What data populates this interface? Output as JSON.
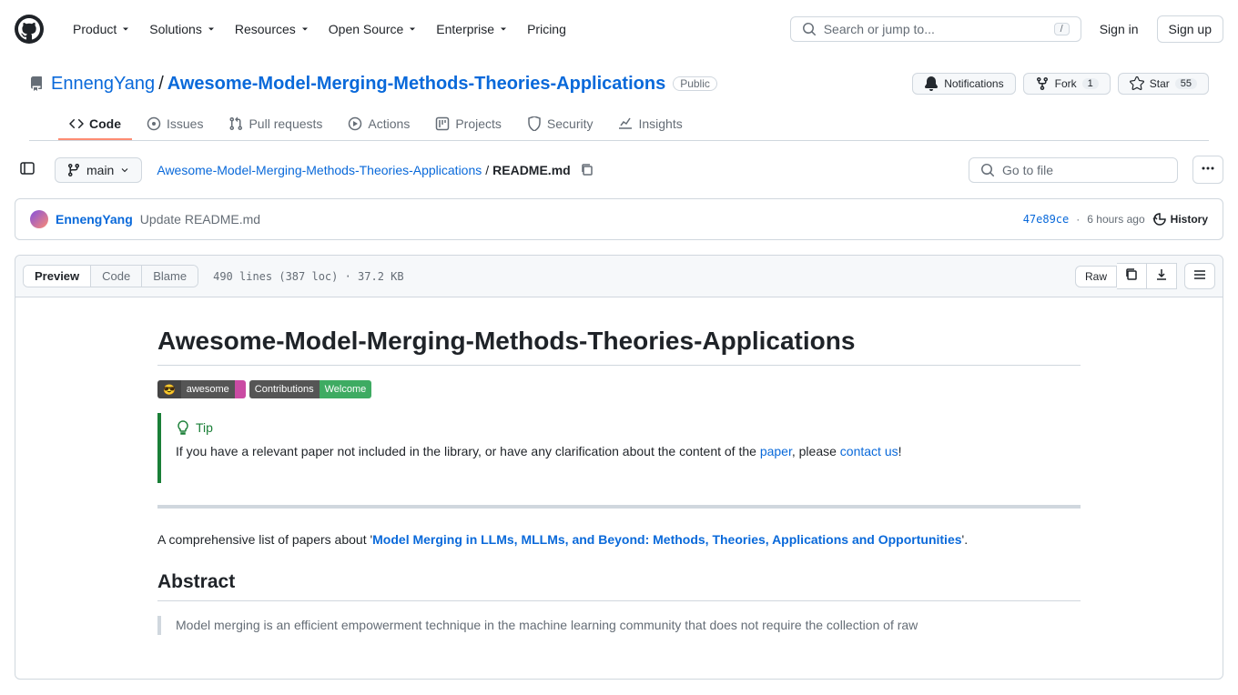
{
  "nav": {
    "product": "Product",
    "solutions": "Solutions",
    "resources": "Resources",
    "opensource": "Open Source",
    "enterprise": "Enterprise",
    "pricing": "Pricing",
    "searchPlaceholder": "Search or jump to...",
    "signin": "Sign in",
    "signup": "Sign up"
  },
  "repo": {
    "owner": "EnnengYang",
    "name": "Awesome-Model-Merging-Methods-Theories-Applications",
    "visibility": "Public",
    "notifications": "Notifications",
    "fork": "Fork",
    "forkCount": "1",
    "star": "Star",
    "starCount": "55"
  },
  "tabs": {
    "code": "Code",
    "issues": "Issues",
    "pulls": "Pull requests",
    "actions": "Actions",
    "projects": "Projects",
    "security": "Security",
    "insights": "Insights"
  },
  "fileNav": {
    "branch": "main",
    "repoLink": "Awesome-Model-Merging-Methods-Theories-Applications",
    "fileName": "README.md",
    "goToFile": "Go to file"
  },
  "commit": {
    "author": "EnnengYang",
    "message": "Update README.md",
    "sha": "47e89ce",
    "time": "6 hours ago",
    "history": "History"
  },
  "fileView": {
    "preview": "Preview",
    "code": "Code",
    "blame": "Blame",
    "info": "490 lines (387 loc) · 37.2 KB",
    "raw": "Raw"
  },
  "md": {
    "title": "Awesome-Model-Merging-Methods-Theories-Applications",
    "badge1Left": "😎 awesome",
    "badge2Left": "Contributions",
    "badge2Right": "Welcome",
    "tipLabel": "Tip",
    "tipTextPre": "If you have a relevant paper not included in the library, or have any clarification about the content of the ",
    "tipLinkPaper": "paper",
    "tipTextMid": ", please ",
    "tipLinkContact": "contact us",
    "tipTextPost": "!",
    "introPre": "A comprehensive list of papers about '",
    "introLink": "Model Merging in LLMs, MLLMs, and Beyond: Methods, Theories, Applications and Opportunities",
    "introPost": "'.",
    "abstractHeading": "Abstract",
    "abstractBody": "Model merging is an efficient empowerment technique in the machine learning community that does not require the collection of raw"
  }
}
